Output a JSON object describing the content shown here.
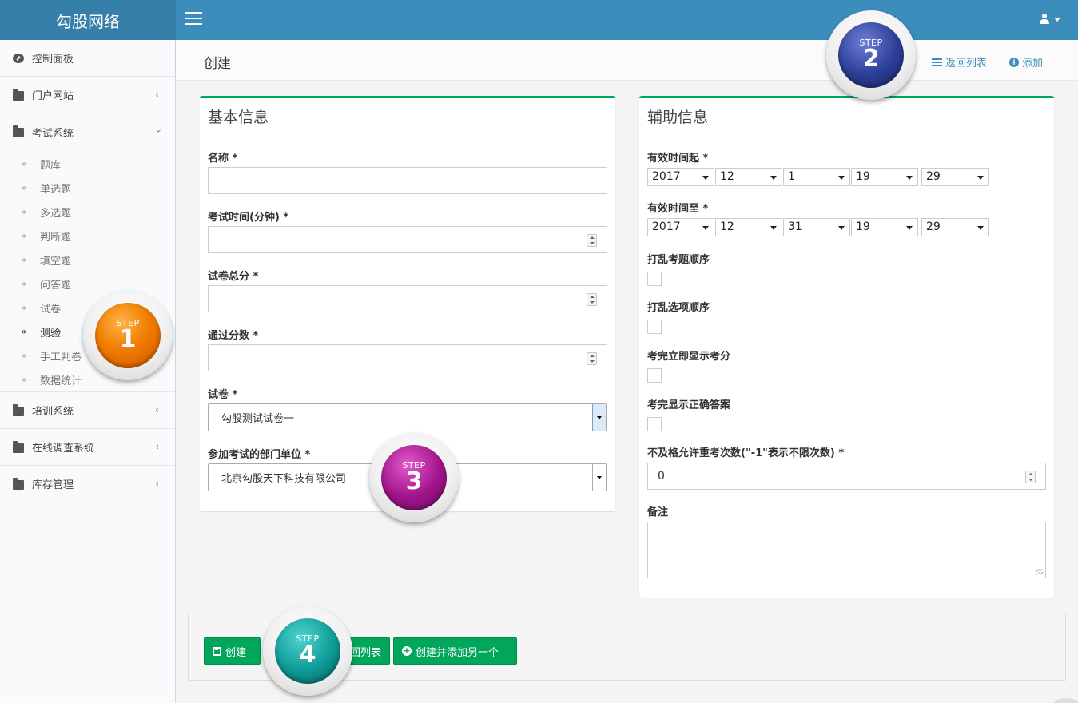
{
  "app": {
    "brand": "勾股网络"
  },
  "sidebar": {
    "items": [
      {
        "label": "控制面板",
        "icon": "dashboard-icon"
      },
      {
        "label": "门户网站",
        "icon": "folder-icon",
        "arrow": "‹"
      },
      {
        "label": "考试系统",
        "icon": "folder-icon",
        "arrow": "›"
      },
      {
        "label": "培训系统",
        "icon": "folder-icon",
        "arrow": "‹"
      },
      {
        "label": "在线调查系统",
        "icon": "folder-icon",
        "arrow": "‹"
      },
      {
        "label": "库存管理",
        "icon": "folder-icon",
        "arrow": "‹"
      }
    ],
    "sub_items": [
      "题库",
      "单选题",
      "多选题",
      "判断题",
      "填空题",
      "问答题",
      "试卷",
      "测验",
      "手工判卷",
      "数据统计"
    ],
    "active_sub": "测验",
    "chevron": "»"
  },
  "header": {
    "title": "创建",
    "back_link": "返回列表",
    "add_link": "添加"
  },
  "basic": {
    "title": "基本信息",
    "name_label": "名称 *",
    "name_value": "",
    "duration_label": "考试时间(分钟) *",
    "duration_value": "",
    "total_label": "试卷总分 *",
    "total_value": "",
    "pass_label": "通过分数 *",
    "pass_value": "",
    "paper_label": "试卷 *",
    "paper_value": "勾股测试试卷一",
    "dept_label": "参加考试的部门单位 *",
    "dept_value": "北京勾股天下科技有限公司"
  },
  "aux": {
    "title": "辅助信息",
    "start_label": "有效时间起 *",
    "start": {
      "year": "2017",
      "month": "12",
      "day": "1",
      "hour": "19",
      "minute": "29"
    },
    "end_label": "有效时间至 *",
    "end": {
      "year": "2017",
      "month": "12",
      "day": "31",
      "hour": "19",
      "minute": "29"
    },
    "colon": ":",
    "shuffle_questions_label": "打乱考题顺序",
    "shuffle_options_label": "打乱选项顺序",
    "show_score_label": "考完立即显示考分",
    "show_answer_label": "考完显示正确答案",
    "retake_label": "不及格允许重考次数(\"-1\"表示不限次数) *",
    "retake_value": "0",
    "remark_label": "备注"
  },
  "footer": {
    "create_label": "创建",
    "back_label": "返回列表",
    "create_another_label": "创建并添加另一个"
  },
  "steps": [
    {
      "label": "STEP",
      "num": "1"
    },
    {
      "label": "STEP",
      "num": "2"
    },
    {
      "label": "STEP",
      "num": "3"
    },
    {
      "label": "STEP",
      "num": "4"
    }
  ],
  "colors": {
    "header": "#3c8dbc",
    "logo": "#367fa9",
    "success": "#00a65a"
  }
}
